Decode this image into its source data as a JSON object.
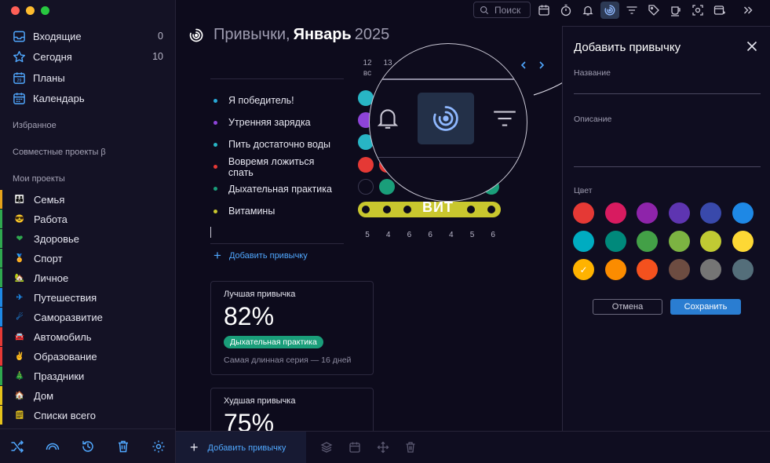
{
  "sidebar": {
    "nav": [
      {
        "label": "Входящие",
        "count": "0",
        "icon": "inbox-icon"
      },
      {
        "label": "Сегодня",
        "count": "10",
        "icon": "star-icon"
      },
      {
        "label": "Планы",
        "count": "",
        "icon": "calendar-29-icon"
      },
      {
        "label": "Календарь",
        "count": "",
        "icon": "calendar-icon"
      }
    ],
    "favorites_label": "Избранное",
    "shared_label": "Совместные проекты β",
    "projects_label": "Мои проекты",
    "projects": [
      {
        "label": "Семья",
        "color": "#e5a21b",
        "icon": "family-emoji"
      },
      {
        "label": "Работа",
        "color": "#2fa84f",
        "icon": "smiling-face-emoji"
      },
      {
        "label": "Здоровье",
        "color": "#2fa84f",
        "icon": "heart-emoji"
      },
      {
        "label": "Спорт",
        "color": "#2fa84f",
        "icon": "medal-emoji"
      },
      {
        "label": "Личное",
        "color": "#2fa84f",
        "icon": "house-garden-emoji"
      },
      {
        "label": "Путешествия",
        "color": "#1e88e5",
        "icon": "airplane-emoji"
      },
      {
        "label": "Саморазвитие",
        "color": "#1e88e5",
        "icon": "comet-emoji"
      },
      {
        "label": "Автомобиль",
        "color": "#e53935",
        "icon": "car-emoji"
      },
      {
        "label": "Образование",
        "color": "#e53935",
        "icon": "victory-hand-emoji"
      },
      {
        "label": "Праздники",
        "color": "#2fa84f",
        "icon": "christmas-tree-emoji"
      },
      {
        "label": "Дом",
        "color": "#e5c21b",
        "icon": "house-emoji"
      },
      {
        "label": "Списки всего",
        "color": "#e5c21b",
        "icon": "notepad-emoji"
      }
    ]
  },
  "toolbar": {
    "search_placeholder": "Поиск"
  },
  "main": {
    "title_prefix": "Привычки,",
    "title_month": "Январь",
    "title_year": "2025",
    "days": [
      {
        "num": "12",
        "dow": "вс"
      },
      {
        "num": "13",
        "dow": ""
      }
    ],
    "habits": [
      {
        "label": "Я победитель!",
        "color": "#28a9d8"
      },
      {
        "label": "Утренняя зарядка",
        "color": "#8e44d9"
      },
      {
        "label": "Пить достаточно воды",
        "color": "#28b5c5"
      },
      {
        "label": "Вовремя ложиться спать",
        "color": "#e53935"
      },
      {
        "label": "Дыхательная практика",
        "color": "#1a9e7a"
      },
      {
        "label": "Витамины",
        "color": "#c9c72e"
      }
    ],
    "add_habit_label": "Добавить привычку",
    "best_card": {
      "label": "Лучшая привычка",
      "percent": "82%",
      "habit": "Дыхательная практика",
      "streak": "Самая длинная серия — 16 дней"
    },
    "worst_card": {
      "label": "Худшая привычка",
      "percent": "75%"
    },
    "totals": [
      "5",
      "4",
      "6",
      "6",
      "4",
      "5",
      "6"
    ],
    "streak_text": "ВИТ"
  },
  "bottom": {
    "add_habit_label": "Добавить привычку"
  },
  "panel": {
    "title": "Добавить привычку",
    "name_label": "Название",
    "description_label": "Описание",
    "color_label": "Цвет",
    "colors": [
      "#e53935",
      "#d81b60",
      "#8e24aa",
      "#5e35b1",
      "#3949ab",
      "#1e88e5",
      "#00acc1",
      "#00897b",
      "#43a047",
      "#7cb342",
      "#c0ca33",
      "#fdd835",
      "#ffb300",
      "#fb8c00",
      "#f4511e",
      "#6d4c41",
      "#757575",
      "#546e7a"
    ],
    "selected_color": "#ffb300",
    "cancel_label": "Отмена",
    "save_label": "Сохранить"
  }
}
